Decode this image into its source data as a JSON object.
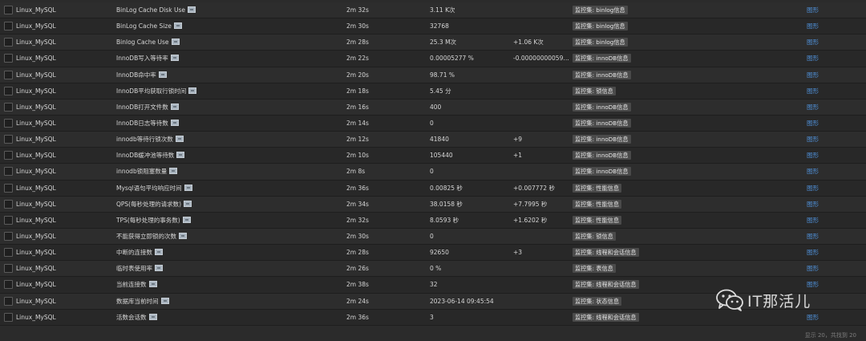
{
  "rows": [
    {
      "host": "Linux_MySQL",
      "item": "BinLog Cache Disk Use",
      "age": "2m 32s",
      "value": "3.11 K次",
      "change": "",
      "tag": "监控集: binlog信息",
      "graph": "图形"
    },
    {
      "host": "Linux_MySQL",
      "item": "BinLog Cache Size",
      "age": "2m 30s",
      "value": "32768",
      "change": "",
      "tag": "监控集: binlog信息",
      "graph": "图形"
    },
    {
      "host": "Linux_MySQL",
      "item": "Binlog Cache Use",
      "age": "2m 28s",
      "value": "25.3 M次",
      "change": "+1.06 K次",
      "tag": "监控集: binlog信息",
      "graph": "图形"
    },
    {
      "host": "Linux_MySQL",
      "item": "InnoDB写入等待率",
      "age": "2m 22s",
      "value": "0.00005277 %",
      "change": "-0.000000000598...",
      "tag": "监控集: innoDB信息",
      "graph": "图形"
    },
    {
      "host": "Linux_MySQL",
      "item": "InnoDB命中率",
      "age": "2m 20s",
      "value": "98.71 %",
      "change": "",
      "tag": "监控集: innoDB信息",
      "graph": "图形"
    },
    {
      "host": "Linux_MySQL",
      "item": "InnoDB平均获取行锁时间",
      "age": "2m 18s",
      "value": "5.45 分",
      "change": "",
      "tag": "监控集: 锁信息",
      "graph": "图形"
    },
    {
      "host": "Linux_MySQL",
      "item": "InnoDB打开文件数",
      "age": "2m 16s",
      "value": "400",
      "change": "",
      "tag": "监控集: innoDB信息",
      "graph": "图形"
    },
    {
      "host": "Linux_MySQL",
      "item": "InnoDB日志等待数",
      "age": "2m 14s",
      "value": "0",
      "change": "",
      "tag": "监控集: innoDB信息",
      "graph": "图形"
    },
    {
      "host": "Linux_MySQL",
      "item": "innodb等待行锁次数",
      "age": "2m 12s",
      "value": "41840",
      "change": "+9",
      "tag": "监控集: innoDB信息",
      "graph": "图形"
    },
    {
      "host": "Linux_MySQL",
      "item": "InnoDB缓冲池等待数",
      "age": "2m 10s",
      "value": "105440",
      "change": "+1",
      "tag": "监控集: innoDB信息",
      "graph": "图形"
    },
    {
      "host": "Linux_MySQL",
      "item": "innodb锁阻塞数量",
      "age": "2m 8s",
      "value": "0",
      "change": "",
      "tag": "监控集: innoDB信息",
      "graph": "图形"
    },
    {
      "host": "Linux_MySQL",
      "item": "Mysql语句平均响应时间",
      "age": "2m 36s",
      "value": "0.00825 秒",
      "change": "+0.007772 秒",
      "tag": "监控集: 性能信息",
      "graph": "图形"
    },
    {
      "host": "Linux_MySQL",
      "item": "QPS(每秒处理的请求数)",
      "age": "2m 34s",
      "value": "38.0158 秒",
      "change": "+7.7995 秒",
      "tag": "监控集: 性能信息",
      "graph": "图形"
    },
    {
      "host": "Linux_MySQL",
      "item": "TPS(每秒处理的事务数)",
      "age": "2m 32s",
      "value": "8.0593 秒",
      "change": "+1.6202 秒",
      "tag": "监控集: 性能信息",
      "graph": "图形"
    },
    {
      "host": "Linux_MySQL",
      "item": "不能获得立即锁的次数",
      "age": "2m 30s",
      "value": "0",
      "change": "",
      "tag": "监控集: 锁信息",
      "graph": "图形"
    },
    {
      "host": "Linux_MySQL",
      "item": "中断的连接数",
      "age": "2m 28s",
      "value": "92650",
      "change": "+3",
      "tag": "监控集: 线程和会话信息",
      "graph": "图形"
    },
    {
      "host": "Linux_MySQL",
      "item": "临时表使用率",
      "age": "2m 26s",
      "value": "0 %",
      "change": "",
      "tag": "监控集: 表信息",
      "graph": "图形"
    },
    {
      "host": "Linux_MySQL",
      "item": "当前连接数",
      "age": "2m 38s",
      "value": "32",
      "change": "",
      "tag": "监控集: 线程和会话信息",
      "graph": "图形"
    },
    {
      "host": "Linux_MySQL",
      "item": "数据库当前时间",
      "age": "2m 24s",
      "value": "2023-06-14 09:45:54",
      "change": "",
      "tag": "监控集: 状态信息",
      "graph": ""
    },
    {
      "host": "Linux_MySQL",
      "item": "活数会话数",
      "age": "2m 36s",
      "value": "3",
      "change": "",
      "tag": "监控集: 线程和会话信息",
      "graph": "图形"
    }
  ],
  "footer": "显示 20，共找到 20",
  "watermark": "IT那活儿",
  "icons": {
    "row_item_flag": "info-flag-icon",
    "watermark_logo": "wechat-icon"
  }
}
